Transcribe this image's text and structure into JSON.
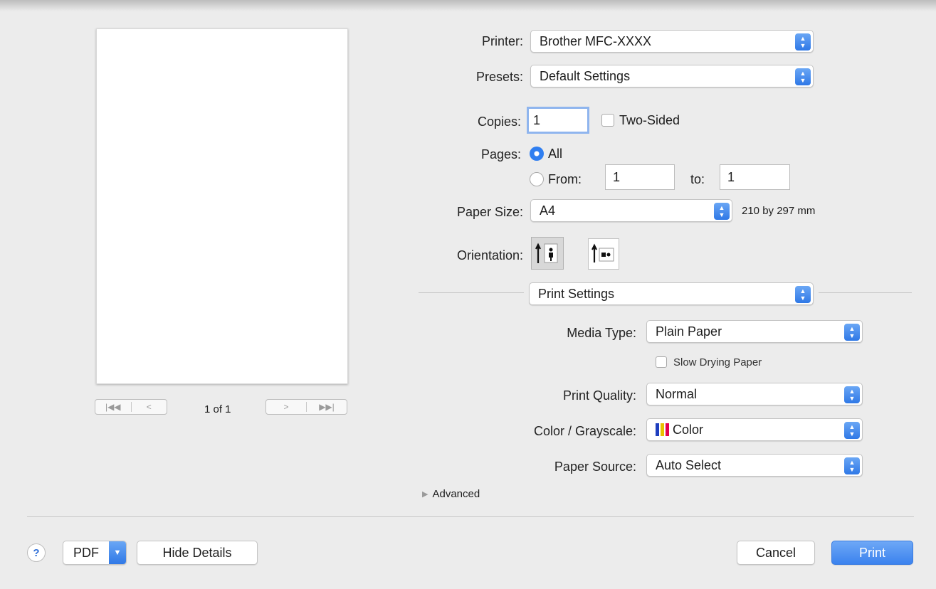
{
  "printer": {
    "label": "Printer:",
    "value": "Brother MFC-XXXX"
  },
  "presets": {
    "label": "Presets:",
    "value": "Default Settings"
  },
  "copies": {
    "label": "Copies:",
    "value": "1",
    "two_sided_label": "Two-Sided",
    "two_sided_checked": false
  },
  "pages": {
    "label": "Pages:",
    "all_label": "All",
    "from_label": "From:",
    "from_value": "1",
    "to_label": "to:",
    "to_value": "1",
    "selected": "All"
  },
  "paper_size": {
    "label": "Paper Size:",
    "value": "A4",
    "dimensions": "210 by 297 mm"
  },
  "orientation": {
    "label": "Orientation:",
    "selected": "portrait",
    "options": [
      "portrait-icon",
      "landscape-icon"
    ]
  },
  "section": {
    "value": "Print Settings"
  },
  "media_type": {
    "label": "Media Type:",
    "value": "Plain Paper",
    "slow_drying_label": "Slow Drying Paper",
    "slow_drying_checked": false
  },
  "print_quality": {
    "label": "Print Quality:",
    "value": "Normal"
  },
  "color_grayscale": {
    "label": "Color / Grayscale:",
    "value": "Color",
    "swatch": [
      "#1f3fbf",
      "#e8c000",
      "#e2004f"
    ]
  },
  "paper_source": {
    "label": "Paper Source:",
    "value": "Auto Select"
  },
  "advanced": {
    "label": "Advanced"
  },
  "preview": {
    "page_indicator": "1 of 1"
  },
  "footer": {
    "help": "?",
    "pdf": "PDF",
    "hide_details": "Hide Details",
    "cancel": "Cancel",
    "print": "Print"
  },
  "colors": {
    "accent": "#3b82ee",
    "background": "#ececec"
  }
}
